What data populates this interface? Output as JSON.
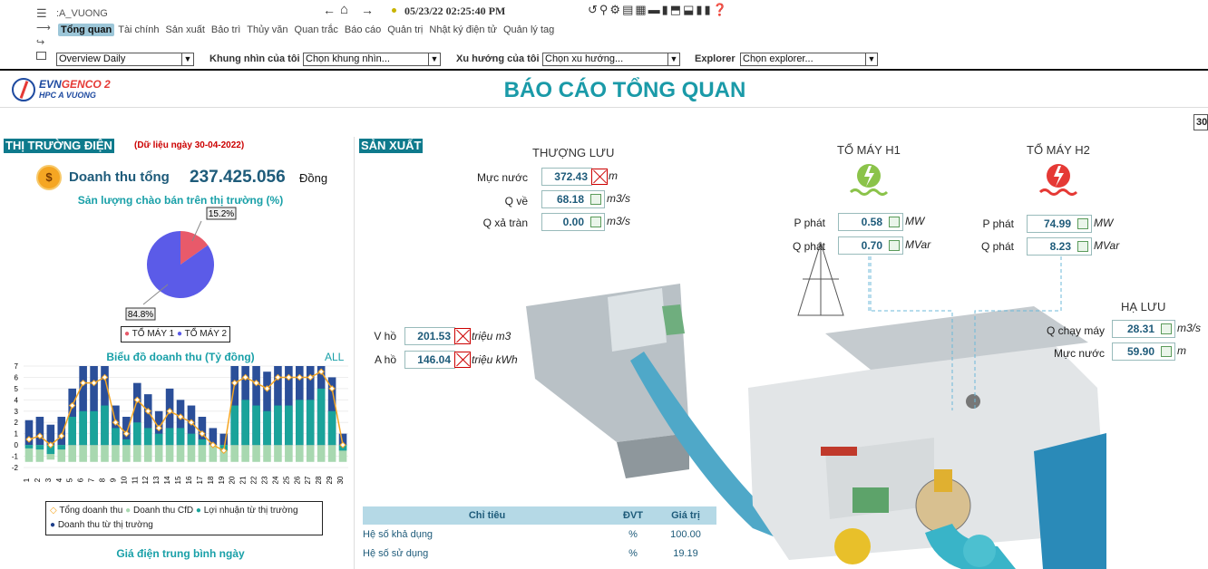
{
  "toolbar": {
    "path": ":A_VUONG",
    "datetime": "05/23/22 02:25:40 PM"
  },
  "tabs": [
    "Tổng quan",
    "Tài chính",
    "Sản xuất",
    "Bảo trì",
    "Thủy văn",
    "Quan trắc",
    "Báo cáo",
    "Quản trị",
    "Nhật ký điện tử",
    "Quản lý tag"
  ],
  "filters": {
    "overview_value": "Overview Daily",
    "khung_label": "Khung nhìn của tôi",
    "khung_value": "Chọn khung nhìn...",
    "xuhuong_label": "Xu hướng của tôi",
    "xuhuong_value": "Chọn xu hướng...",
    "explorer_label": "Explorer",
    "explorer_value": "Chọn explorer..."
  },
  "header": {
    "logo_evn": "EVN",
    "logo_genco": "GENCO 2",
    "logo_sub": "HPC A VUONG",
    "title": "BÁO CÁO TỔNG QUAN",
    "right_input": "30"
  },
  "market": {
    "title": "THỊ TRƯỜNG ĐIỆN",
    "note": "(Dữ liệu ngày 30-04-2022)",
    "revenue_label": "Doanh thu tổng",
    "revenue_value": "237.425.056",
    "revenue_unit": "Đồng",
    "pie_title": "Sản lượng chào bán trên thị trường (%)",
    "pie_label_small": "15.2%",
    "pie_label_big": "84.8%",
    "legend": [
      "TỔ MÁY 1",
      "TỔ MÁY 2"
    ],
    "bar_title": "Biểu đồ doanh thu (Tỷ đồng)",
    "bar_all": "ALL",
    "bar_legend": [
      "Tổng doanh thu",
      "Doanh thu CfD",
      "Lợi nhuận từ thị trường",
      "Doanh thu từ thị trường"
    ],
    "price_title": "Giá điện trung bình ngày"
  },
  "production": {
    "title": "SẢN XUẤT",
    "upstream_title": "THƯỢNG LƯU",
    "upstream": [
      {
        "label": "Mực nước",
        "value": "372.43",
        "unit": "m"
      },
      {
        "label": "Q về",
        "value": "68.18",
        "unit": "m3/s"
      },
      {
        "label": "Q xả tràn",
        "value": "0.00",
        "unit": "m3/s"
      }
    ],
    "h1_title": "TỔ MÁY H1",
    "h2_title": "TỔ MÁY H2",
    "h1": [
      {
        "label": "P phát",
        "value": "0.58",
        "unit": "MW"
      },
      {
        "label": "Q phát",
        "value": "0.70",
        "unit": "MVar"
      }
    ],
    "h2": [
      {
        "label": "P phát",
        "value": "74.99",
        "unit": "MW"
      },
      {
        "label": "Q phát",
        "value": "8.23",
        "unit": "MVar"
      }
    ],
    "reservoir": [
      {
        "label": "V hồ",
        "value": "201.53",
        "unit": "triệu m3"
      },
      {
        "label": "A hồ",
        "value": "146.04",
        "unit": "triệu kWh"
      }
    ],
    "downstream_title": "HẠ LƯU",
    "downstream": [
      {
        "label": "Q chạy máy",
        "value": "28.31",
        "unit": "m3/s"
      },
      {
        "label": "Mực nước",
        "value": "59.90",
        "unit": "m"
      }
    ],
    "kpi_headers": [
      "Chỉ tiêu",
      "ĐVT",
      "Giá trị"
    ],
    "kpi_rows": [
      [
        "Hệ số khả dụng",
        "%",
        "100.00"
      ],
      [
        "Hệ số sử dụng",
        "%",
        "19.19"
      ]
    ]
  },
  "colors": {
    "accent": "#0e7a8c",
    "title": "#1a9aa8",
    "h1_icon": "#8bc34a",
    "h2_icon": "#e53935"
  },
  "chart_data": [
    {
      "type": "pie",
      "title": "Sản lượng chào bán trên thị trường (%)",
      "labels": [
        "TỔ MÁY 1",
        "TỔ MÁY 2"
      ],
      "values": [
        15.2,
        84.8
      ],
      "colors": [
        "#e85a6a",
        "#5b5be8"
      ]
    },
    {
      "type": "bar",
      "title": "Biểu đồ doanh thu (Tỷ đồng)",
      "categories": [
        "1",
        "2",
        "3",
        "4",
        "5",
        "6",
        "7",
        "8",
        "9",
        "10",
        "11",
        "12",
        "13",
        "14",
        "15",
        "16",
        "17",
        "18",
        "19",
        "20",
        "21",
        "22",
        "23",
        "24",
        "25",
        "26",
        "27",
        "28",
        "29",
        "30"
      ],
      "ylim": [
        -2,
        7
      ],
      "series": [
        {
          "name": "Doanh thu CfD",
          "values": [
            -1.5,
            -1.5,
            -1.3,
            -1.5,
            -1.5,
            -1.5,
            -1.5,
            -1.5,
            -1.5,
            -1.5,
            -1.5,
            -1.5,
            -1.5,
            -1.5,
            -1.5,
            -1.5,
            -1.5,
            -1.5,
            -1.5,
            -1.5,
            -1.5,
            -1.5,
            -1.5,
            -1.5,
            -1.5,
            -1.5,
            -1.5,
            -1.5,
            -1.5,
            -1.5
          ]
        },
        {
          "name": "Lợi nhuận từ thị trường",
          "values": [
            -0.3,
            -0.4,
            -0.8,
            -0.4,
            2.5,
            3.0,
            3.0,
            3.5,
            1.5,
            0.5,
            2.0,
            1.5,
            1.0,
            1.5,
            1.5,
            1.0,
            0.5,
            0.0,
            -0.5,
            3.5,
            4.0,
            3.5,
            3.0,
            3.5,
            3.5,
            4.0,
            4.0,
            5.0,
            3.0,
            -0.5
          ]
        },
        {
          "name": "Doanh thu từ thị trường",
          "values": [
            2.2,
            2.5,
            1.8,
            2.5,
            5.0,
            7.0,
            7.0,
            7.0,
            3.5,
            2.5,
            5.5,
            4.5,
            3.0,
            5.0,
            4.0,
            3.5,
            2.5,
            1.5,
            1.0,
            7.0,
            7.0,
            7.0,
            6.5,
            7.0,
            7.0,
            7.0,
            7.0,
            7.0,
            6.0,
            1.0
          ]
        },
        {
          "name": "Tổng doanh thu",
          "values": [
            0.5,
            0.8,
            0.0,
            0.8,
            3.5,
            5.5,
            5.5,
            6.0,
            2.0,
            1.0,
            4.0,
            3.0,
            1.5,
            3.0,
            2.5,
            2.0,
            1.0,
            0.0,
            -0.5,
            5.5,
            6.0,
            5.5,
            5.0,
            6.0,
            6.0,
            6.0,
            6.0,
            6.5,
            5.0,
            0.0
          ]
        }
      ]
    }
  ]
}
